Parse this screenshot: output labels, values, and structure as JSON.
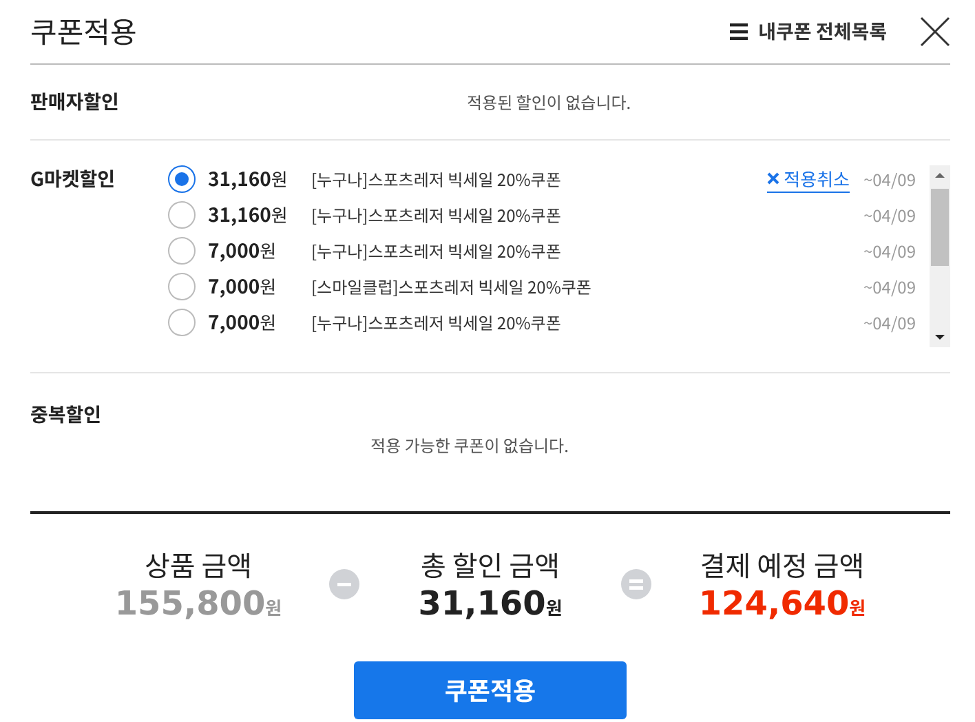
{
  "header": {
    "title": "쿠폰적용",
    "list_link": "내쿠폰 전체목록"
  },
  "seller_discount": {
    "label": "판매자할인",
    "message": "적용된 할인이 없습니다."
  },
  "gmarket_discount": {
    "label": "G마켓할인",
    "coupons": [
      {
        "amount": "31,160",
        "unit": "원",
        "name": "[누구나]스포츠레저 빅세일 20%쿠폰",
        "selected": true,
        "cancel": "적용취소",
        "date": "~04/09"
      },
      {
        "amount": "31,160",
        "unit": "원",
        "name": "[누구나]스포츠레저 빅세일 20%쿠폰",
        "selected": false,
        "date": "~04/09"
      },
      {
        "amount": "7,000",
        "unit": "원",
        "name": "[누구나]스포츠레저 빅세일 20%쿠폰",
        "selected": false,
        "date": "~04/09"
      },
      {
        "amount": "7,000",
        "unit": "원",
        "name": "[스마일클럽]스포츠레저 빅세일 20%쿠폰",
        "selected": false,
        "date": "~04/09"
      },
      {
        "amount": "7,000",
        "unit": "원",
        "name": "[누구나]스포츠레저 빅세일 20%쿠폰",
        "selected": false,
        "date": "~04/09"
      }
    ]
  },
  "duplicate_discount": {
    "label": "중복할인",
    "message": "적용 가능한 쿠폰이 없습니다."
  },
  "summary": [
    {
      "label": "상품 금액",
      "amount": "155,800",
      "unit": "원",
      "color": "#999999"
    },
    {
      "kind": "minus"
    },
    {
      "label": "총 할인 금액",
      "amount": "31,160",
      "unit": "원",
      "color": "#222222"
    },
    {
      "kind": "equals"
    },
    {
      "label": "결제 예정 금액",
      "amount": "124,640",
      "unit": "원",
      "color": "#f02a00"
    }
  ],
  "apply_button": "쿠폰적용"
}
